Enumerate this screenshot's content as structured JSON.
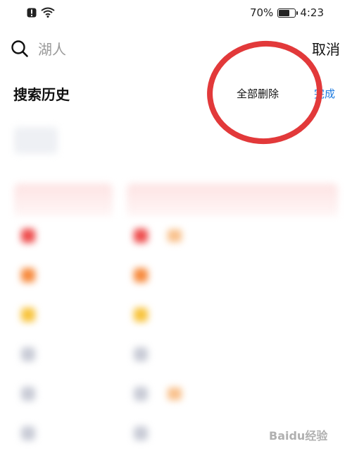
{
  "status_bar": {
    "alert_icon": "alert-badge-icon",
    "wifi_icon": "wifi-icon",
    "battery_percent": "70%",
    "battery_level": 0.7,
    "time": "4:23"
  },
  "search": {
    "placeholder": "湖人",
    "value": "",
    "cancel_label": "取消"
  },
  "history": {
    "title": "搜索历史",
    "delete_all_label": "全部删除",
    "done_label": "完成"
  },
  "colors": {
    "accent_blue": "#1e7be0",
    "annotation_red": "#e2393a"
  },
  "watermark": "Baidu经验"
}
